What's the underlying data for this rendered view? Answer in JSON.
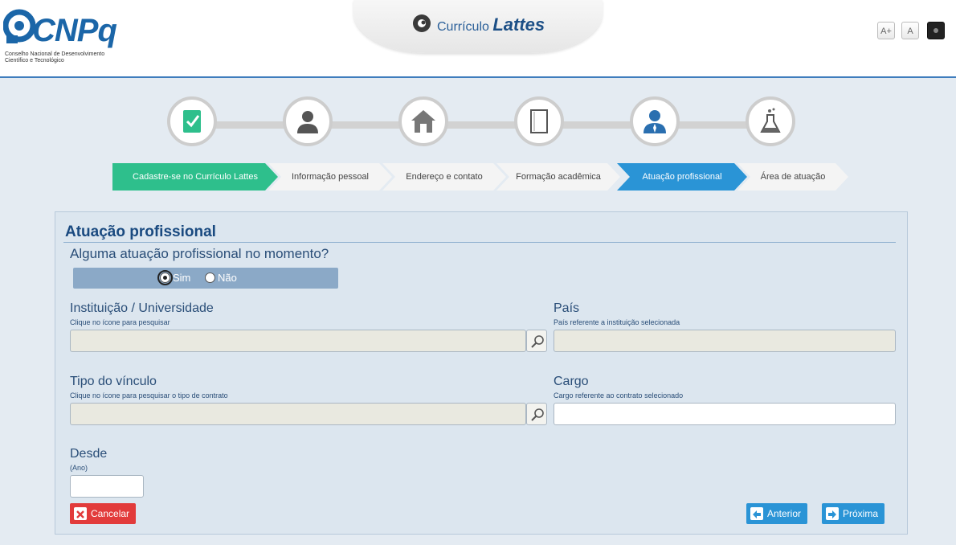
{
  "header": {
    "logo_text": "CNPq",
    "logo_subtitle_line1": "Conselho Nacional de Desenvolvimento",
    "logo_subtitle_line2": "Científico e Tecnológico",
    "app_title_prefix": "Currículo",
    "app_title_main": "Lattes",
    "font_buttons": [
      "A+",
      "A"
    ],
    "contrast_button_icon": "contrast-icon"
  },
  "progress_icons": [
    "checklist-icon",
    "person-icon",
    "house-icon",
    "document-icon",
    "professional-icon",
    "flask-icon"
  ],
  "steps": [
    {
      "label": "Cadastre-se no Currículo Lattes",
      "state": "done"
    },
    {
      "label": "Informação pessoal",
      "state": "pending"
    },
    {
      "label": "Endereço e contato",
      "state": "pending"
    },
    {
      "label": "Formação acadêmica",
      "state": "pending"
    },
    {
      "label": "Atuação profissional",
      "state": "active"
    },
    {
      "label": "Área de atuação",
      "state": "pending"
    }
  ],
  "form": {
    "title": "Atuação profissional",
    "question": "Alguma atuação profissional no momento?",
    "options": [
      "Sim",
      "Não"
    ],
    "selected_option": "Sim",
    "institution": {
      "label": "Instituição / Universidade",
      "hint": "Clique no ícone para pesquisar",
      "value": ""
    },
    "country": {
      "label": "País",
      "hint": "País referente a instituição selecionada",
      "value": ""
    },
    "bond_type": {
      "label": "Tipo do vínculo",
      "hint": "Clique no ícone para pesquisar o tipo de contrato",
      "value": ""
    },
    "position": {
      "label": "Cargo",
      "hint": "Cargo referente ao contrato selecionado",
      "value": ""
    },
    "since": {
      "label": "Desde",
      "hint": "(Ano)",
      "value": ""
    }
  },
  "buttons": {
    "cancel": "Cancelar",
    "previous": "Anterior",
    "next": "Próxima"
  },
  "colors": {
    "brand_blue": "#1b66a8",
    "step_done": "#2ebf8c",
    "step_active": "#2a94d6",
    "cancel": "#e23b3b"
  }
}
